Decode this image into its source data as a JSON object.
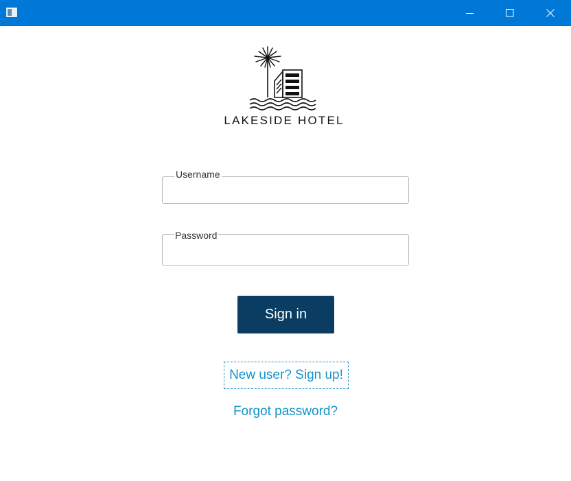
{
  "window": {
    "title": "",
    "controls": [
      "minimize-icon",
      "maximize-icon",
      "close-icon"
    ],
    "accent": "#0078d7"
  },
  "brand": {
    "name": "LAKESIDE HOTEL"
  },
  "form": {
    "username": {
      "label": "Username",
      "value": "",
      "placeholder": ""
    },
    "password": {
      "label": "Password",
      "value": "",
      "placeholder": ""
    },
    "sign_in_label": "Sign in",
    "sign_in_color": "#0b3d63"
  },
  "links": {
    "signup": "New user? Sign up!",
    "forgot": "Forgot password?",
    "link_color": "#1793c6"
  }
}
